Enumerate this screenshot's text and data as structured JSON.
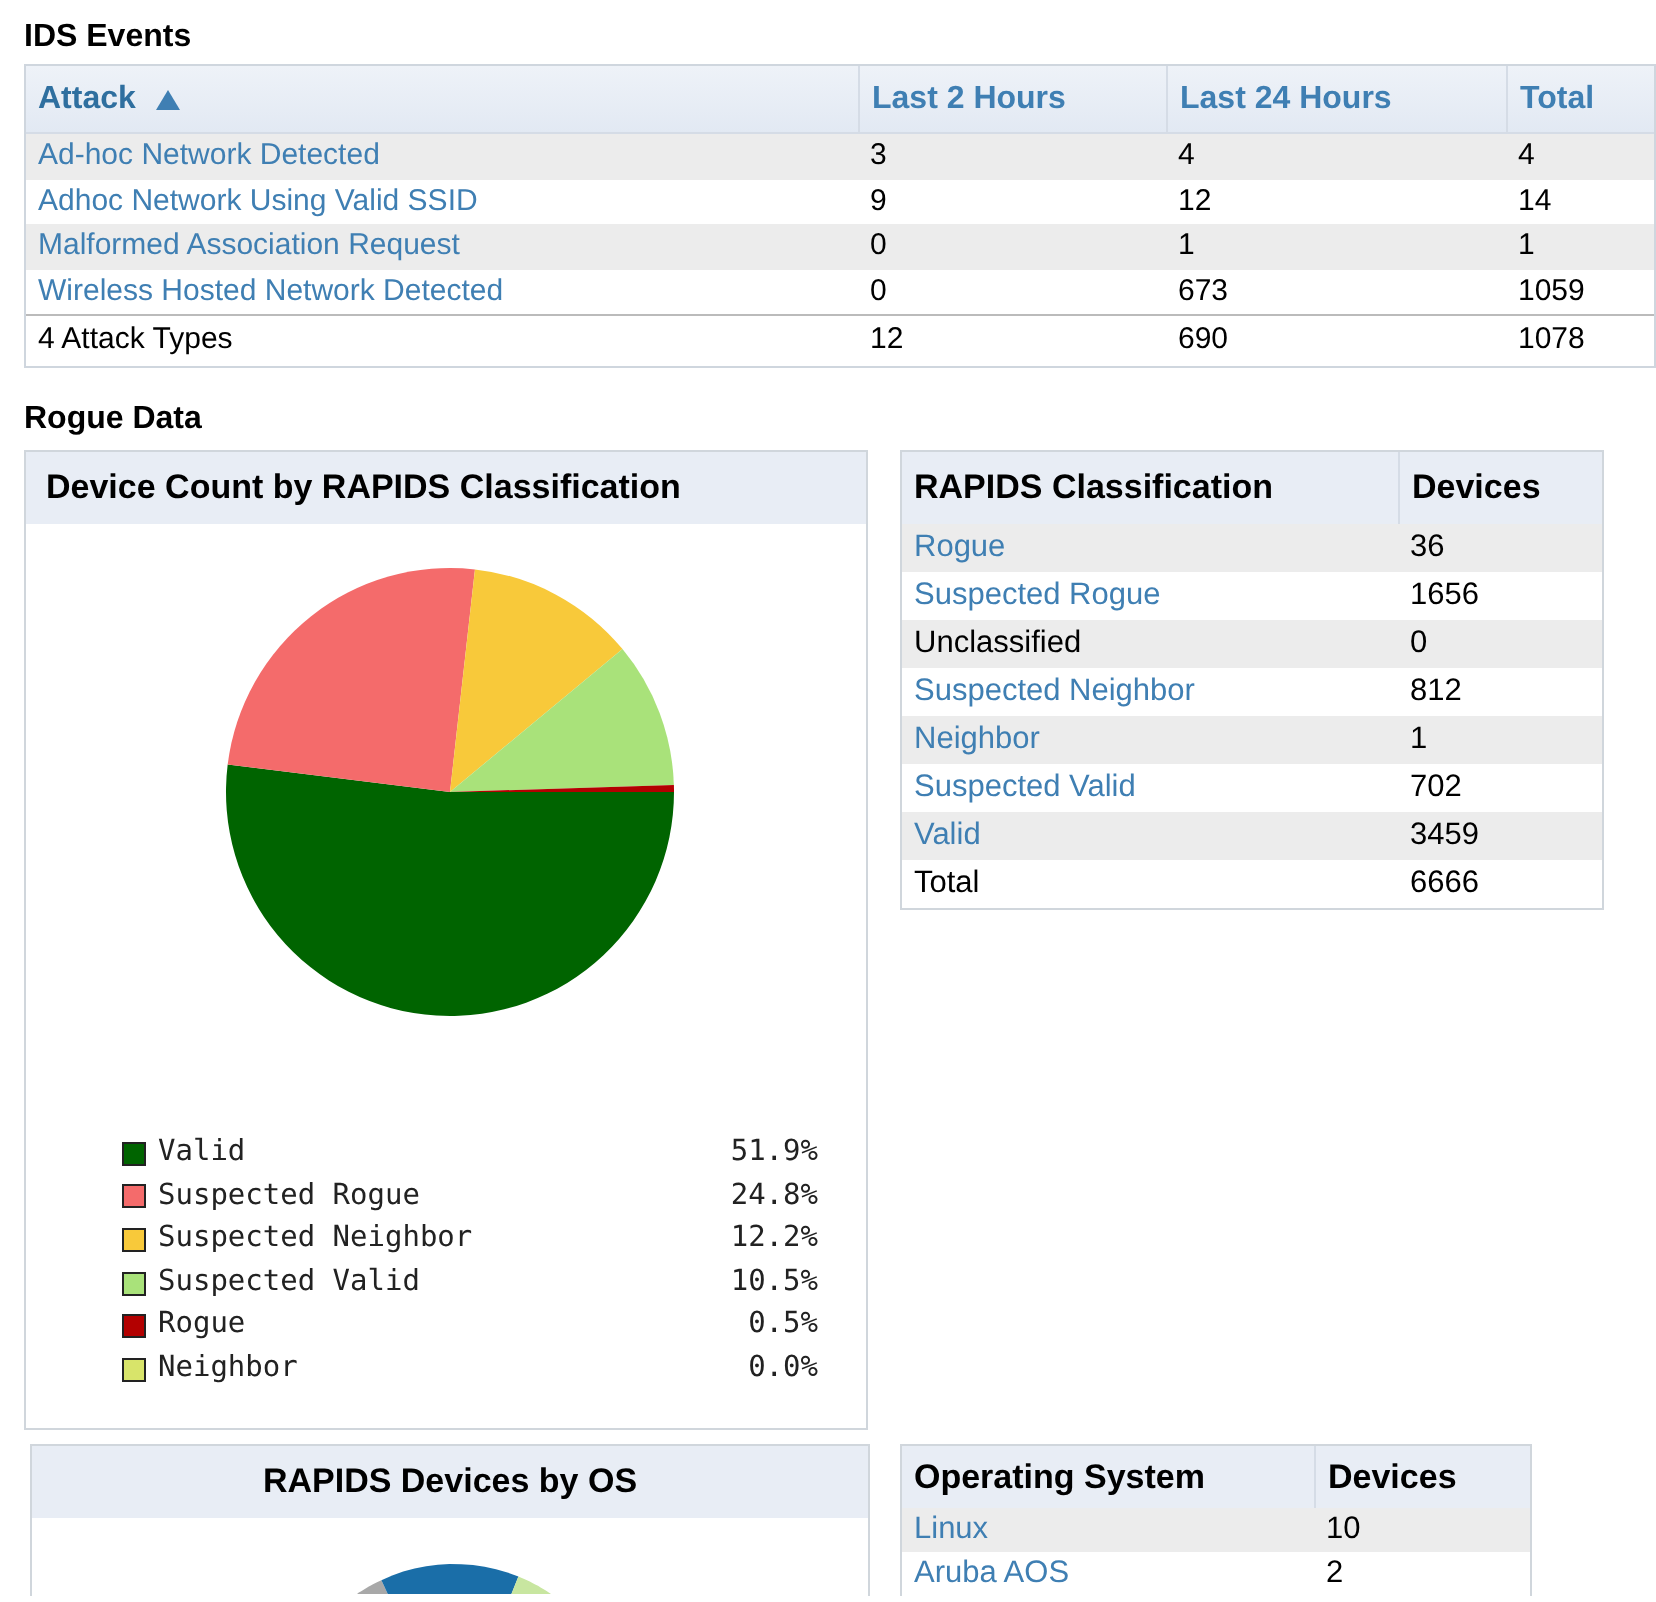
{
  "ids_events": {
    "title": "IDS Events",
    "columns": [
      {
        "label": "Attack",
        "sorted": true
      },
      {
        "label": "Last 2 Hours",
        "sorted": false
      },
      {
        "label": "Last 24 Hours",
        "sorted": false
      },
      {
        "label": "Total",
        "sorted": false
      }
    ],
    "rows": [
      {
        "attack": "Ad-hoc Network Detected",
        "last_2_hours": "3",
        "last_24_hours": "4",
        "total": "4"
      },
      {
        "attack": "Adhoc Network Using Valid SSID",
        "last_2_hours": "9",
        "last_24_hours": "12",
        "total": "14"
      },
      {
        "attack": "Malformed Association Request",
        "last_2_hours": "0",
        "last_24_hours": "1",
        "total": "1"
      },
      {
        "attack": "Wireless Hosted Network Detected",
        "last_2_hours": "0",
        "last_24_hours": "673",
        "total": "1059"
      }
    ],
    "footer": {
      "attack": "4 Attack Types",
      "last_2_hours": "12",
      "last_24_hours": "690",
      "total": "1078"
    }
  },
  "rogue_data": {
    "title": "Rogue Data",
    "classification_chart": {
      "chart_data": {
        "type": "pie",
        "title": "Device Count by RAPIDS Classification",
        "categories": [
          "Valid",
          "Suspected Rogue",
          "Suspected Neighbor",
          "Suspected Valid",
          "Rogue",
          "Neighbor"
        ],
        "values": [
          51.9,
          24.8,
          12.2,
          10.5,
          0.5,
          0.0
        ]
      },
      "legend": [
        {
          "value": "51.9%",
          "color": "#006400"
        },
        {
          "value": "24.8%",
          "color": "#f46b6b"
        },
        {
          "value": "12.2%",
          "color": "#f8c93a"
        },
        {
          "value": "10.5%",
          "color": "#a9e27a"
        },
        {
          "value": "0.5%",
          "color": "#b30000"
        },
        {
          "value": "0.0%",
          "color": "#d8e46a"
        }
      ]
    },
    "classification_table": {
      "columns": [
        "RAPIDS Classification",
        "Devices"
      ],
      "rows": [
        {
          "classification": "Rogue",
          "devices": "36",
          "link": true
        },
        {
          "classification": "Suspected Rogue",
          "devices": "1656",
          "link": true
        },
        {
          "classification": "Unclassified",
          "devices": "0",
          "link": false
        },
        {
          "classification": "Suspected Neighbor",
          "devices": "812",
          "link": true
        },
        {
          "classification": "Neighbor",
          "devices": "1",
          "link": true
        },
        {
          "classification": "Suspected Valid",
          "devices": "702",
          "link": true
        },
        {
          "classification": "Valid",
          "devices": "3459",
          "link": true
        }
      ],
      "footer": {
        "classification": "Total",
        "devices": "6666"
      }
    },
    "os_chart": {
      "title": "RAPIDS Devices by OS"
    },
    "os_table": {
      "columns": [
        "Operating System",
        "Devices"
      ],
      "rows": [
        {
          "os": "Linux",
          "devices": "10",
          "link": true
        },
        {
          "os": "Aruba AOS",
          "devices": "2",
          "link": true
        }
      ]
    }
  }
}
